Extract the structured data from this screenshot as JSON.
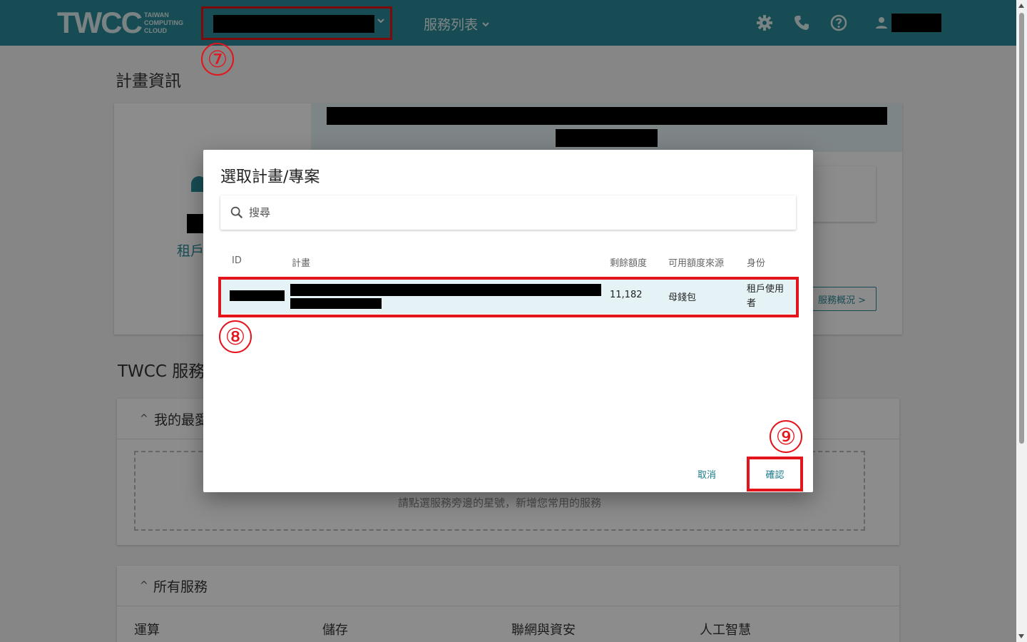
{
  "header": {
    "logo_main": "TWCC",
    "logo_sub": [
      "TAIWAN",
      "COMPUTING",
      "CLOUD"
    ],
    "services_menu": "服務列表"
  },
  "page": {
    "title": "計畫資訊",
    "tenant_label": "租戶",
    "overview_button": "服務概況 >",
    "services_section_title": "TWCC 服務",
    "favorites_title": "我的最愛",
    "favorites_empty_hint": "請點選服務旁邊的星號，新增您常用的服務",
    "all_services_title": "所有服務",
    "categories": [
      "運算",
      "儲存",
      "聯網與資安",
      "人工智慧"
    ]
  },
  "dialog": {
    "title": "選取計畫/專案",
    "search_placeholder": "搜尋",
    "columns": [
      "ID",
      "計畫",
      "剩餘額度",
      "可用額度來源",
      "身份"
    ],
    "rows": [
      {
        "balance": "11,182",
        "source": "母錢包",
        "role": "租戶使用者"
      }
    ],
    "cancel_label": "取消",
    "confirm_label": "確認"
  },
  "annotations": {
    "step7": "⑦",
    "step8": "⑧",
    "step9": "⑨"
  },
  "colors": {
    "header_bg": "#2b8a9a",
    "highlight_red": "#e3141b",
    "selected_row_bg": "#e5f3f6",
    "button_text": "#1a7a8a"
  }
}
